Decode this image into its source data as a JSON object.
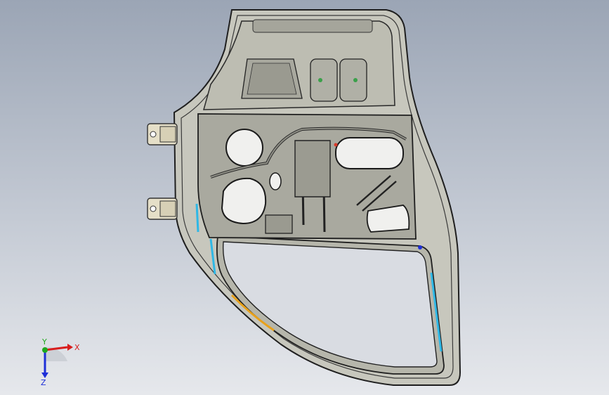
{
  "viewport": {
    "background_top": "#9ba5b5",
    "background_bottom": "#e6e8ec"
  },
  "model": {
    "part": "car-door-inner-panel",
    "body_color": "#c9c9c0",
    "edge_color": "#2a2a2a",
    "hole_color": "#f2f2f2",
    "accent_colors": [
      "#2fb8e6",
      "#e8a11a",
      "#3aa04a",
      "#d83a2a"
    ]
  },
  "triad": {
    "x_label": "X",
    "y_label": "Y",
    "z_label": "Z",
    "x_color": "#d81e1e",
    "y_color": "#1ea81e",
    "z_color": "#1e2fd8"
  }
}
